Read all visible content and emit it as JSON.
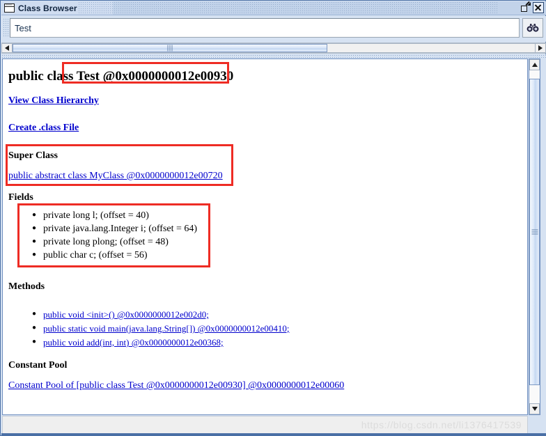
{
  "window": {
    "title": "Class Browser",
    "icon": "window-icon",
    "buttons": {
      "restore": "restore-down",
      "close": "close"
    }
  },
  "toolbar": {
    "search_value": "Test",
    "search_placeholder": "",
    "search_icon": "binoculars-icon"
  },
  "scrollbars": {
    "horizontal": {
      "left_arrow": "◀",
      "right_arrow": "▶"
    },
    "vertical": {
      "up_arrow": "▲",
      "down_arrow": "▼"
    }
  },
  "document": {
    "title": "public class Test @0x0000000012e00930",
    "links": [
      {
        "label": "View Class Hierarchy"
      },
      {
        "label": "Create .class File"
      }
    ],
    "super_class": {
      "heading": "Super Class",
      "link": "public abstract class MyClass @0x0000000012e00720"
    },
    "fields": {
      "heading": "Fields",
      "items": [
        "private long l; (offset = 40)",
        "private java.lang.Integer i; (offset = 64)",
        "private long plong; (offset = 48)",
        "public char c; (offset = 56)"
      ]
    },
    "methods": {
      "heading": "Methods",
      "items": [
        "public void <init>() @0x0000000012e002d0;",
        "public static void main(java.lang.String[]) @0x0000000012e00410;",
        "public void add(int, int) @0x0000000012e00368;"
      ]
    },
    "constant_pool": {
      "heading": "Constant Pool",
      "link": "Constant Pool of [public class Test @0x0000000012e00930] @0x0000000012e00060"
    }
  },
  "watermark": "https://blog.csdn.net/li1376417539",
  "colors": {
    "highlight_box": "#ee2c24",
    "link": "#0000cd",
    "frame": "#4a6fa5",
    "titlebar": "#cfdcf0"
  }
}
